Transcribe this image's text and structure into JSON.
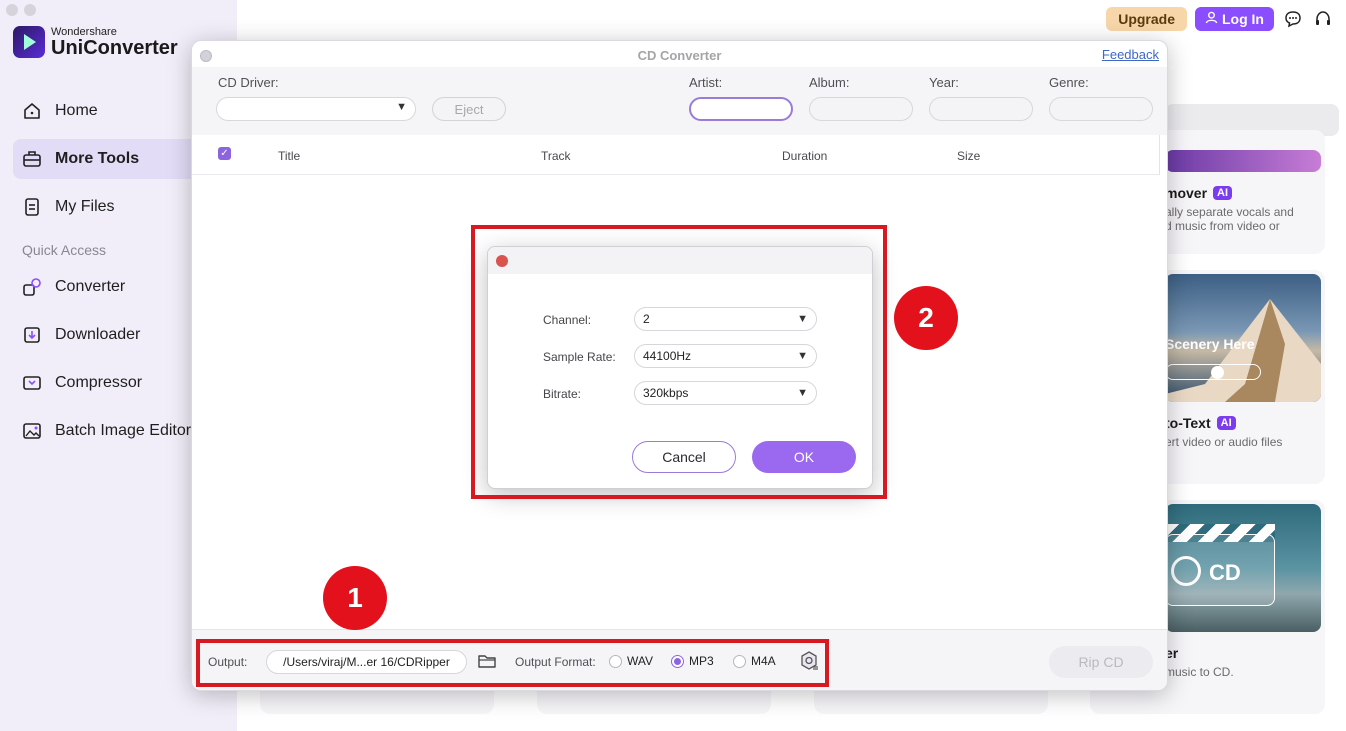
{
  "app": {
    "brand_small": "Wondershare",
    "brand_big": "UniConverter",
    "upgrade_label": "Upgrade",
    "login_label": "Log In"
  },
  "sidebar": {
    "items": [
      {
        "label": "Home",
        "icon": "home-icon"
      },
      {
        "label": "More Tools",
        "icon": "toolbox-icon",
        "active": true
      },
      {
        "label": "My Files",
        "icon": "file-icon"
      }
    ],
    "quick_access_label": "Quick Access",
    "quick_items": [
      {
        "label": "Converter",
        "icon": "converter-icon"
      },
      {
        "label": "Downloader",
        "icon": "download-icon"
      },
      {
        "label": "Compressor",
        "icon": "compress-icon"
      },
      {
        "label": "Batch Image Editor",
        "icon": "image-edit-icon"
      }
    ]
  },
  "background_cards": [
    {
      "title": "mover",
      "ai": "AI",
      "desc1": "ally separate vocals and",
      "desc2": "d music from video or"
    },
    {
      "thumb_text": "Scenery Here",
      "title": "to-Text",
      "ai": "AI",
      "desc1": "ert video or audio files"
    },
    {
      "thumb_text": "CD",
      "title": "er",
      "desc1": "music to CD."
    }
  ],
  "cd_converter": {
    "title": "CD Converter",
    "feedback_label": "Feedback",
    "fields": {
      "cd_driver_label": "CD Driver:",
      "eject_label": "Eject",
      "artist_label": "Artist:",
      "album_label": "Album:",
      "year_label": "Year:",
      "genre_label": "Genre:"
    },
    "table_headers": [
      "Title",
      "Track",
      "Duration",
      "Size"
    ],
    "footer": {
      "output_label": "Output:",
      "output_path": "/Users/viraj/M...er 16/CDRipper",
      "format_label": "Output Format:",
      "formats": [
        "WAV",
        "MP3",
        "M4A"
      ],
      "selected_format": "MP3",
      "rip_label": "Rip CD"
    }
  },
  "settings_dialog": {
    "channel_label": "Channel:",
    "channel_value": "2",
    "sample_rate_label": "Sample Rate:",
    "sample_rate_value": "44100Hz",
    "bitrate_label": "Bitrate:",
    "bitrate_value": "320kbps",
    "cancel_label": "Cancel",
    "ok_label": "OK"
  },
  "annotations": {
    "step1": "1",
    "step2": "2",
    "highlight_color": "#d71921"
  },
  "colors": {
    "accent": "#8a4dff",
    "sidebar_bg": "#f1eef9",
    "ok_button": "#9b69f0"
  }
}
